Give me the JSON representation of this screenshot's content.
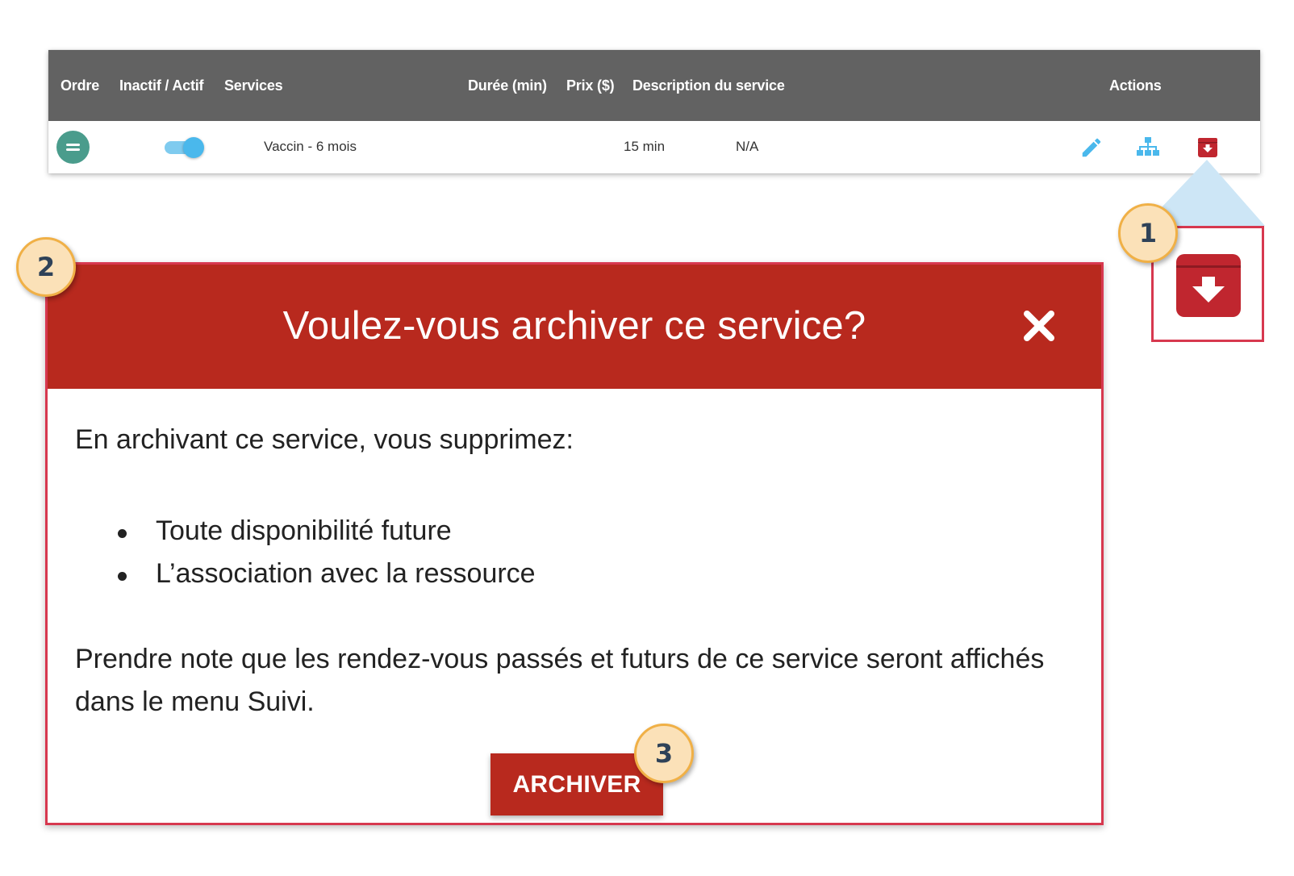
{
  "table": {
    "headers": {
      "order": "Ordre",
      "status": "Inactif / Actif",
      "services": "Services",
      "duration": "Durée (min)",
      "price": "Prix ($)",
      "description": "Description du service",
      "actions": "Actions"
    },
    "rows": [
      {
        "service": "Vaccin - 6 mois",
        "duration": "15 min",
        "description": "N/A",
        "active": true
      }
    ],
    "icons": [
      "drag-handle-icon",
      "toggle-switch",
      "pencil-icon",
      "sitemap-icon",
      "archive-icon"
    ]
  },
  "steps": {
    "one": "1",
    "two": "2",
    "three": "3"
  },
  "modal": {
    "title": "Voulez-vous archiver ce service?",
    "intro": "En archivant ce service, vous supprimez:",
    "bullets": [
      "Toute disponibilité future",
      "L’association avec la ressource"
    ],
    "note": "Prendre note que les rendez-vous passés et futurs de ce service seront affichés dans le menu Suivi.",
    "button_label": "ARCHIVER"
  },
  "colors": {
    "header_gray": "#626262",
    "danger_red": "#b8291e",
    "callout_border": "#d7384f",
    "accent_blue": "#4ab8ec",
    "teal": "#4a9c8c",
    "badge_fill": "#fbe1b8",
    "badge_border": "#f0b046"
  }
}
